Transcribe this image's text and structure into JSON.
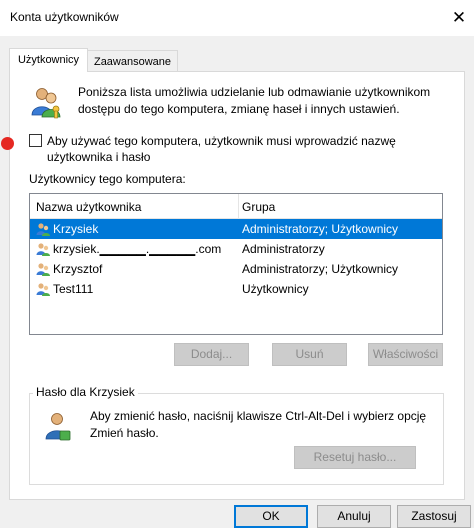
{
  "window": {
    "title": "Konta użytkowników",
    "close_glyph": "✕"
  },
  "tabs": [
    {
      "label": "Użytkownicy",
      "active": true
    },
    {
      "label": "Zaawansowane",
      "active": false
    }
  ],
  "intro": {
    "text": "Poniższa lista umożliwia udzielanie lub odmawianie użytkownikom dostępu do tego komputera, zmianę haseł i innych ustawień.",
    "icon": "users-keys-icon"
  },
  "require_login": {
    "label": "Aby używać tego komputera, użytkownik musi wprowadzić nazwę użytkownika i hasło",
    "checked": false
  },
  "users": {
    "section_label": "Użytkownicy tego komputera:",
    "columns": [
      "Nazwa użytkownika",
      "Grupa"
    ],
    "rows": [
      {
        "name": "Krzysiek",
        "group": "Administratorzy; Użytkownicy",
        "selected": true
      },
      {
        "name": "krzysiek.▁▁▁▁▁.▁▁▁▁▁.com",
        "group": "Administratorzy",
        "selected": false
      },
      {
        "name": "Krzysztof",
        "group": "Administratorzy; Użytkownicy",
        "selected": false
      },
      {
        "name": "Test111",
        "group": "Użytkownicy",
        "selected": false
      }
    ]
  },
  "list_buttons": {
    "add": "Dodaj...",
    "remove": "Usuń",
    "properties": "Właściwości"
  },
  "password": {
    "group_title": "Hasło dla Krzysiek",
    "text": "Aby zmienić hasło, naciśnij klawisze Ctrl-Alt-Del i wybierz opcję Zmień hasło.",
    "reset_button": "Resetuj hasło..."
  },
  "footer": {
    "ok": "OK",
    "cancel": "Anuluj",
    "apply": "Zastosuj"
  },
  "colors": {
    "accent": "#0078d7",
    "marker": "#e52822"
  }
}
